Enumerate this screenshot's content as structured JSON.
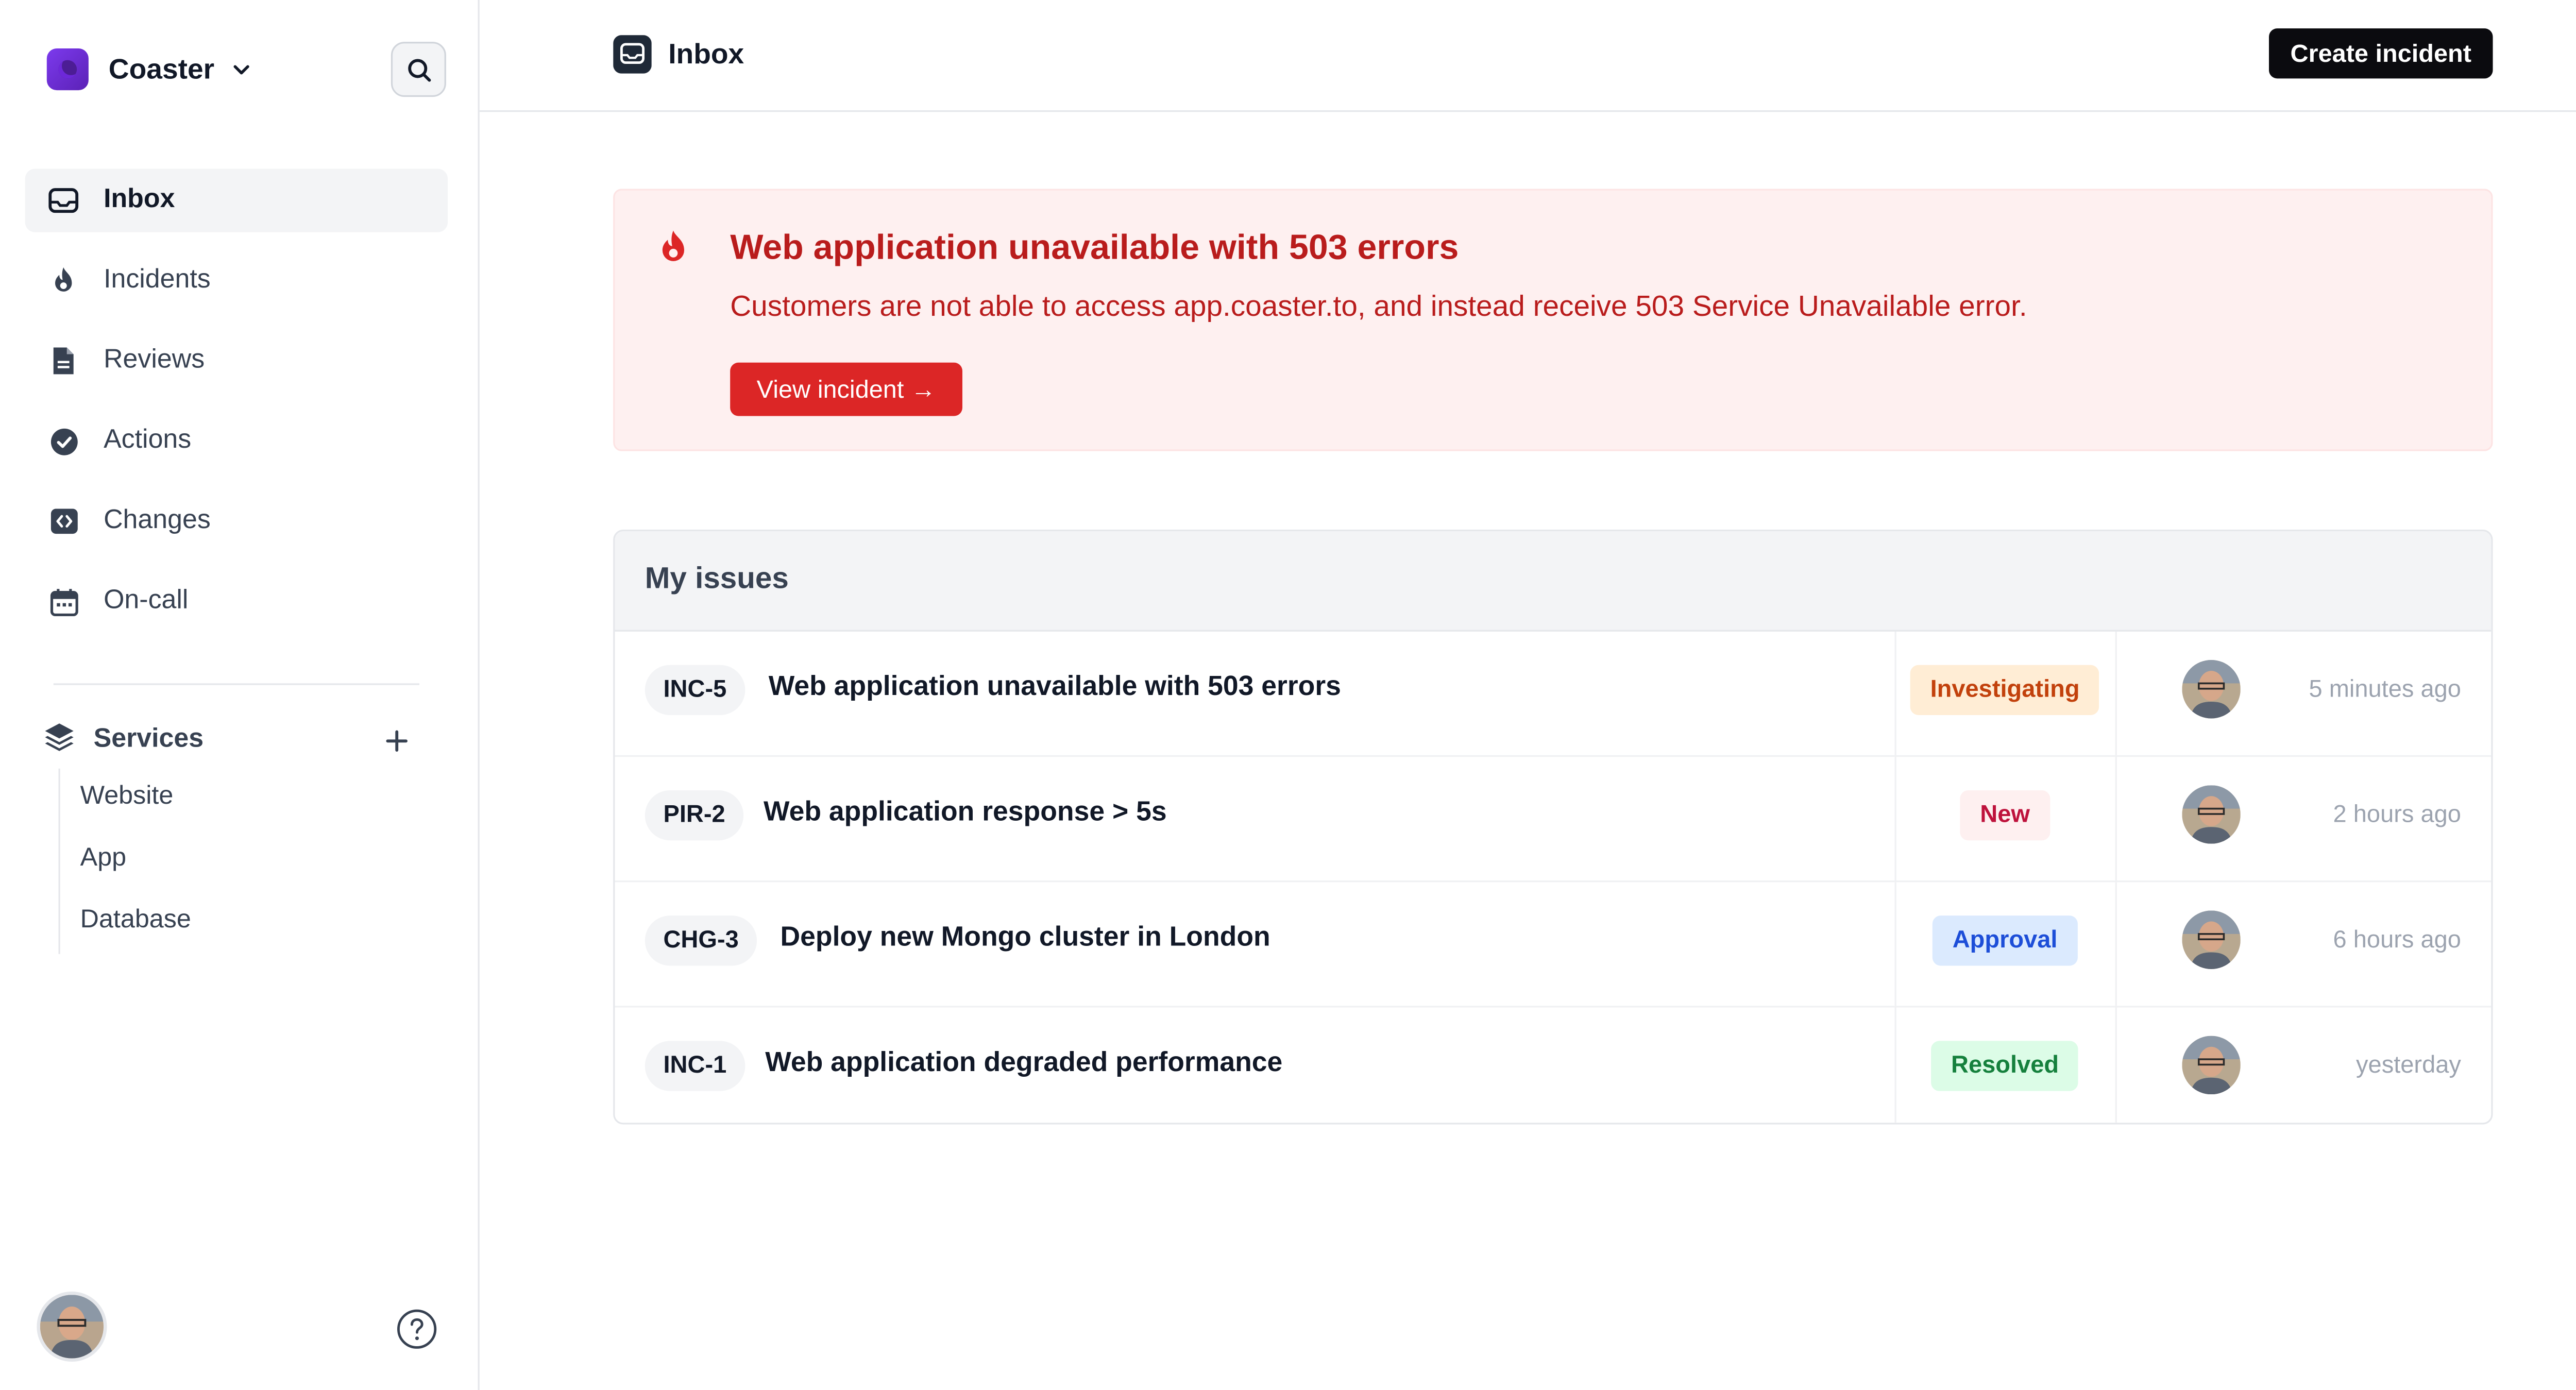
{
  "workspace": {
    "name": "Coaster"
  },
  "sidebar": {
    "items": [
      {
        "label": "Inbox",
        "icon": "inbox-icon",
        "active": true
      },
      {
        "label": "Incidents",
        "icon": "flame-icon"
      },
      {
        "label": "Reviews",
        "icon": "document-icon"
      },
      {
        "label": "Actions",
        "icon": "check-circle-icon"
      },
      {
        "label": "Changes",
        "icon": "code-square-icon"
      },
      {
        "label": "On-call",
        "icon": "calendar-icon"
      }
    ],
    "services_label": "Services",
    "services": [
      "Website",
      "App",
      "Database"
    ]
  },
  "header": {
    "title": "Inbox",
    "create_label": "Create incident"
  },
  "alert": {
    "title": "Web application unavailable with 503 errors",
    "description": "Customers are not able to access app.coaster.to, and instead receive 503 Service Unavailable error.",
    "button_label": "View incident →",
    "color": "#dc2626"
  },
  "issues": {
    "title": "My issues",
    "rows": [
      {
        "ref": "INC-5",
        "title": "Web application unavailable with 503 errors",
        "status": "Investigating",
        "time": "5 minutes ago"
      },
      {
        "ref": "PIR-2",
        "title": "Web application response > 5s",
        "status": "New",
        "time": "2 hours ago"
      },
      {
        "ref": "CHG-3",
        "title": "Deploy new Mongo cluster in London",
        "status": "Approval",
        "time": "6 hours ago"
      },
      {
        "ref": "INC-1",
        "title": "Web application degraded performance",
        "status": "Resolved",
        "time": "yesterday"
      }
    ]
  }
}
